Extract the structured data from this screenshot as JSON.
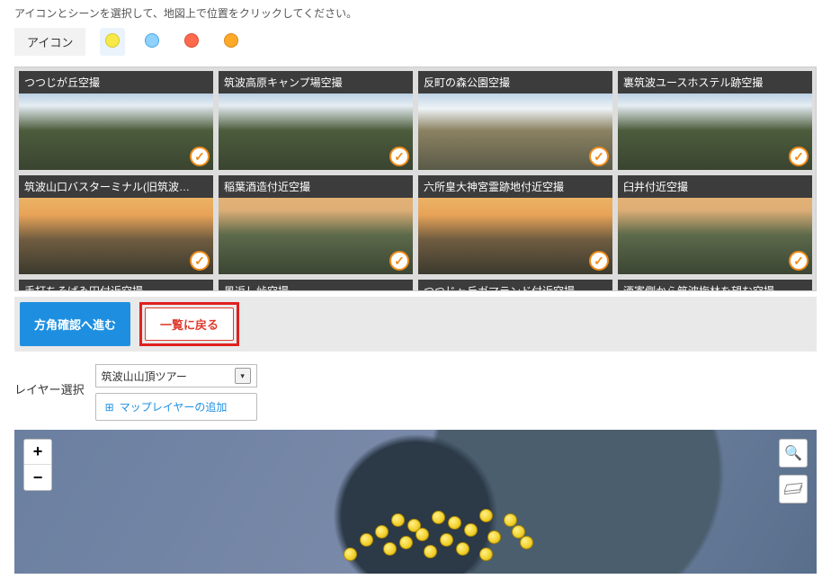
{
  "instruction": "アイコンとシーンを選択して、地図上で位置をクリックしてください。",
  "iconbar": {
    "label": "アイコン",
    "selected": "yellow",
    "options": [
      "yellow",
      "blue",
      "red",
      "orange"
    ]
  },
  "scenes": [
    {
      "title": "つつじが丘空撮",
      "variant": "var1",
      "checked": true
    },
    {
      "title": "筑波高原キャンプ場空撮",
      "variant": "var1",
      "checked": true
    },
    {
      "title": "反町の森公園空撮",
      "variant": "var2",
      "checked": true
    },
    {
      "title": "裏筑波ユースホステル跡空撮",
      "variant": "var1",
      "checked": true
    },
    {
      "title": "筑波山口バスターミナル(旧筑波…",
      "variant": "var3",
      "checked": true
    },
    {
      "title": "稲葉酒造付近空撮",
      "variant": "var4",
      "checked": true
    },
    {
      "title": "六所皇大神宮霊跡地付近空撮",
      "variant": "var3",
      "checked": true
    },
    {
      "title": "臼井付近空撮",
      "variant": "var4",
      "checked": true
    },
    {
      "title": "手打ちそばゐ田付近空撮",
      "short": true
    },
    {
      "title": "風返し峠空撮",
      "short": true
    },
    {
      "title": "つつじヶ丘ガマランド付近空撮",
      "short": true
    },
    {
      "title": "酒寄側から筑波梅林を望む空撮",
      "short": true
    }
  ],
  "actions": {
    "proceed": "方角確認へ進む",
    "back": "一覧に戻る"
  },
  "layer": {
    "label": "レイヤー選択",
    "selected": "筑波山山頂ツアー",
    "add_label": "マップレイヤーの追加"
  },
  "map": {
    "zoom_in": "+",
    "zoom_out": "−",
    "markers": [
      {
        "x": 47,
        "y": 58
      },
      {
        "x": 52,
        "y": 56
      },
      {
        "x": 49,
        "y": 62
      },
      {
        "x": 54,
        "y": 60
      },
      {
        "x": 58,
        "y": 55
      },
      {
        "x": 61,
        "y": 58
      },
      {
        "x": 56,
        "y": 65
      },
      {
        "x": 50,
        "y": 68
      },
      {
        "x": 45,
        "y": 66
      },
      {
        "x": 48,
        "y": 74
      },
      {
        "x": 53,
        "y": 72
      },
      {
        "x": 59,
        "y": 70
      },
      {
        "x": 62,
        "y": 66
      },
      {
        "x": 55,
        "y": 78
      },
      {
        "x": 51,
        "y": 80
      },
      {
        "x": 46,
        "y": 78
      },
      {
        "x": 43,
        "y": 72
      },
      {
        "x": 41,
        "y": 82
      },
      {
        "x": 58,
        "y": 82
      },
      {
        "x": 63,
        "y": 74
      }
    ]
  }
}
